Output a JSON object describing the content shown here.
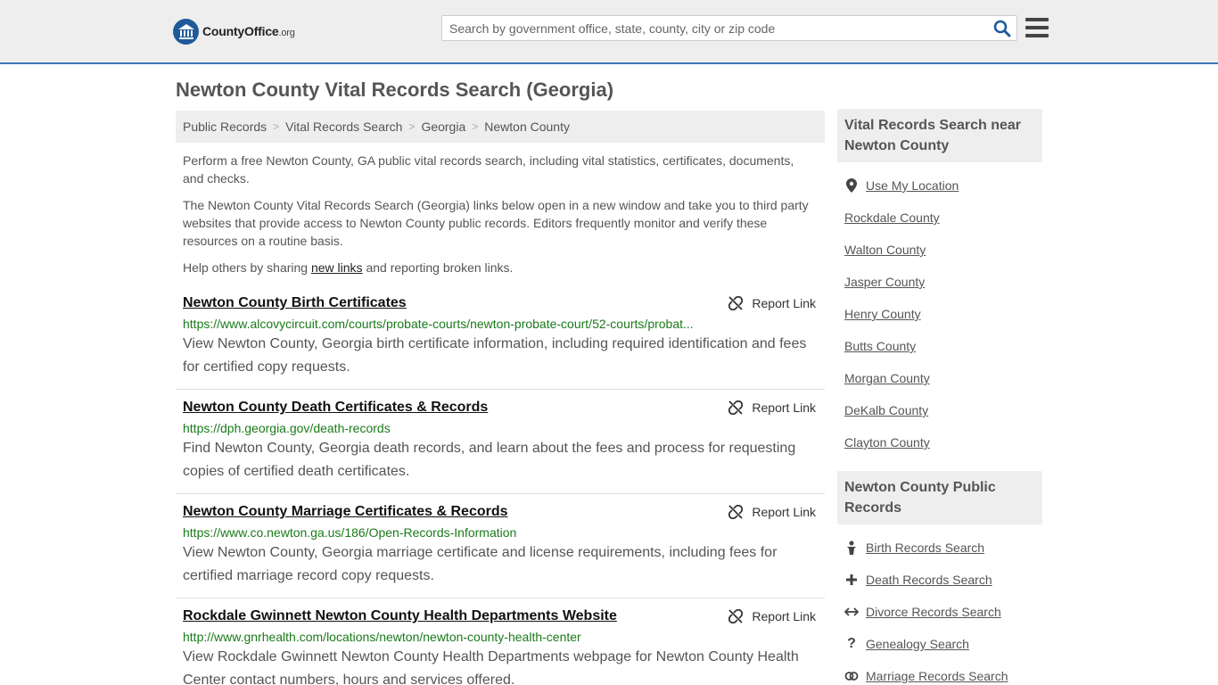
{
  "header": {
    "logo_word": "CountyOffice",
    "logo_tld": ".org",
    "search_placeholder": "Search by government office, state, county, city or zip code"
  },
  "page_title": "Newton County Vital Records Search (Georgia)",
  "breadcrumb": [
    "Public Records",
    "Vital Records Search",
    "Georgia",
    "Newton County"
  ],
  "intro": {
    "p1": "Perform a free Newton County, GA public vital records search, including vital statistics, certificates, documents, and checks.",
    "p2": "The Newton County Vital Records Search (Georgia) links below open in a new window and take you to third party websites that provide access to Newton County public records. Editors frequently monitor and verify these resources on a routine basis.",
    "p3_before": "Help others by sharing ",
    "p3_link": "new links",
    "p3_after": " and reporting broken links."
  },
  "report_label": "Report Link",
  "results": [
    {
      "title": "Newton County Birth Certificates",
      "url": "https://www.alcovycircuit.com/courts/probate-courts/newton-probate-court/52-courts/probat...",
      "desc": "View Newton County, Georgia birth certificate information, including required identification and fees for certified copy requests."
    },
    {
      "title": "Newton County Death Certificates & Records",
      "url": "https://dph.georgia.gov/death-records",
      "desc": "Find Newton County, Georgia death records, and learn about the fees and process for requesting copies of certified death certificates."
    },
    {
      "title": "Newton County Marriage Certificates & Records",
      "url": "https://www.co.newton.ga.us/186/Open-Records-Information",
      "desc": "View Newton County, Georgia marriage certificate and license requirements, including fees for certified marriage record copy requests."
    },
    {
      "title": "Rockdale Gwinnett Newton County Health Departments Website",
      "url": "http://www.gnrhealth.com/locations/newton/newton-county-health-center",
      "desc": "View Rockdale Gwinnett Newton County Health Departments webpage for Newton County Health Center contact numbers, hours and services offered."
    }
  ],
  "sidebar": {
    "near_heading": "Vital Records Search near Newton County",
    "use_location": "Use My Location",
    "near": [
      "Rockdale County",
      "Walton County",
      "Jasper County",
      "Henry County",
      "Butts County",
      "Morgan County",
      "DeKalb County",
      "Clayton County"
    ],
    "public_heading": "Newton County Public Records",
    "public": [
      {
        "label": "Birth Records Search",
        "icon": "baby-icon"
      },
      {
        "label": "Death Records Search",
        "icon": "cross-icon"
      },
      {
        "label": "Divorce Records Search",
        "icon": "arrows-split-icon"
      },
      {
        "label": "Genealogy Search",
        "icon": "question-icon"
      },
      {
        "label": "Marriage Records Search",
        "icon": "rings-icon"
      }
    ]
  }
}
